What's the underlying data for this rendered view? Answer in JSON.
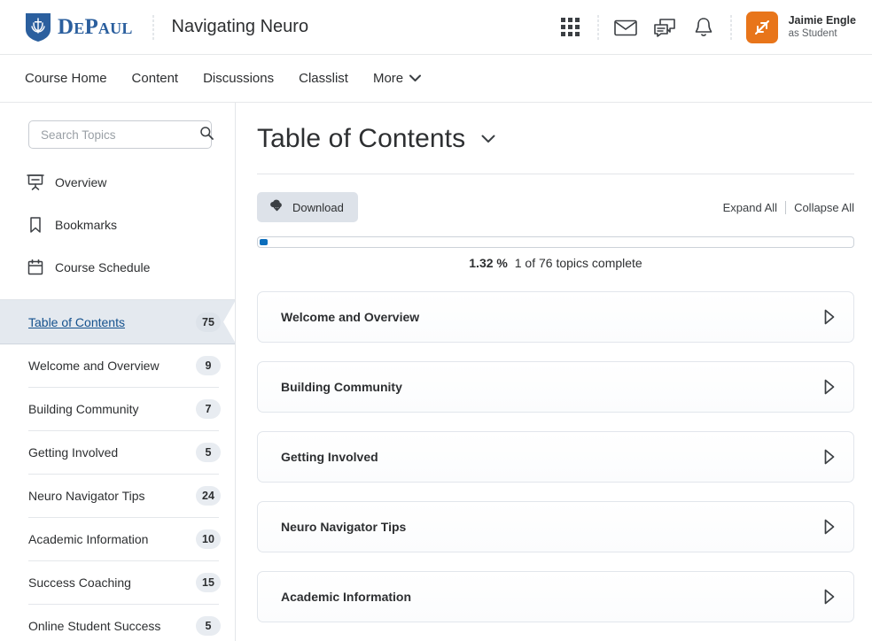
{
  "header": {
    "brand_word": "DePaul",
    "course_title": "Navigating Neuro",
    "icons": [
      "waffle-grid-icon",
      "envelope-icon",
      "chat-bubble-icon",
      "bell-icon"
    ],
    "user": {
      "name": "Jaimie Engle",
      "role": "as Student",
      "avatar_icon": "swap-arrows-icon",
      "avatar_color": "#e8751a"
    }
  },
  "nav": {
    "items": [
      {
        "label": "Course Home"
      },
      {
        "label": "Content"
      },
      {
        "label": "Discussions"
      },
      {
        "label": "Classlist"
      },
      {
        "label": "More"
      }
    ],
    "more_caret_icon": "chevron-down-icon"
  },
  "sidebar": {
    "search": {
      "placeholder": "Search Topics",
      "value": "",
      "icon": "search-icon"
    },
    "quick_links": [
      {
        "label": "Overview",
        "icon": "presentation-icon"
      },
      {
        "label": "Bookmarks",
        "icon": "bookmark-icon"
      },
      {
        "label": "Course Schedule",
        "icon": "calendar-icon"
      }
    ],
    "toc_items": [
      {
        "label": "Table of Contents",
        "count": "75",
        "selected": true
      },
      {
        "label": "Welcome and Overview",
        "count": "9",
        "selected": false
      },
      {
        "label": "Building Community",
        "count": "7",
        "selected": false
      },
      {
        "label": "Getting Involved",
        "count": "5",
        "selected": false
      },
      {
        "label": "Neuro Navigator Tips",
        "count": "24",
        "selected": false
      },
      {
        "label": "Academic Information",
        "count": "10",
        "selected": false
      },
      {
        "label": "Success Coaching",
        "count": "15",
        "selected": false
      },
      {
        "label": "Online Student Success",
        "count": "5",
        "selected": false
      }
    ]
  },
  "main": {
    "page_title": "Table of Contents",
    "title_caret_icon": "chevron-down-icon",
    "download_label": "Download",
    "download_icon": "cloud-download-icon",
    "expand_all_label": "Expand All",
    "collapse_all_label": "Collapse All",
    "progress": {
      "percent_label": "1.32 %",
      "percent_value": 1.32,
      "status_text": "1 of 76 topics complete",
      "fill_color": "#0c6ebc"
    },
    "modules": [
      {
        "label": "Welcome and Overview",
        "chevron_icon": "triangle-right-icon"
      },
      {
        "label": "Building Community",
        "chevron_icon": "triangle-right-icon"
      },
      {
        "label": "Getting Involved",
        "chevron_icon": "triangle-right-icon"
      },
      {
        "label": "Neuro Navigator Tips",
        "chevron_icon": "triangle-right-icon"
      },
      {
        "label": "Academic Information",
        "chevron_icon": "triangle-right-icon"
      }
    ]
  }
}
